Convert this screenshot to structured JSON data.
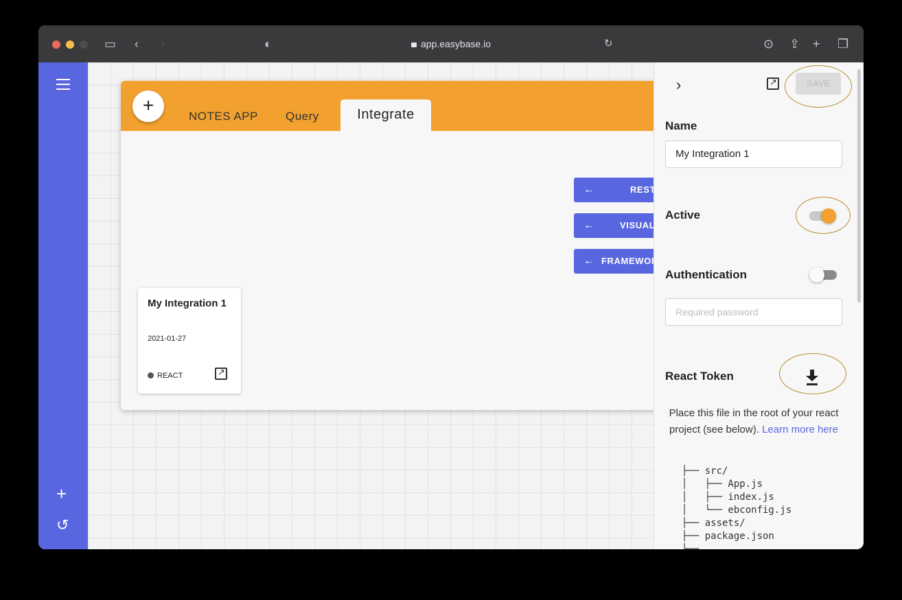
{
  "browser": {
    "url": "app.easybase.io"
  },
  "sidebar": {
    "menu_icon": "hamburger-icon",
    "add_icon": "plus-icon",
    "history_icon": "undo-icon"
  },
  "main": {
    "add_button": "+",
    "tabs": [
      {
        "label": "NOTES APP"
      },
      {
        "label": "Query"
      },
      {
        "label": "Integrate"
      }
    ],
    "actions": [
      {
        "label": "REST"
      },
      {
        "label": "VISUAL"
      },
      {
        "label": "FRAMEWORK"
      }
    ],
    "integration": {
      "title": "My Integration 1",
      "date": "2021-01-27",
      "framework": "REACT"
    }
  },
  "panel": {
    "save_label": "SAVE",
    "name_label": "Name",
    "name_value": "My Integration 1",
    "active_label": "Active",
    "active_on": true,
    "auth_label": "Authentication",
    "auth_on": false,
    "password_placeholder": "Required password",
    "token_label": "React Token",
    "desc_text": "Place this file in the root of your react project (see below).",
    "desc_link": "Learn more here",
    "tree_lines": [
      "├── src/",
      "│   ├── App.js",
      "│   ├── index.js",
      "│   └── ebconfig.js",
      "├── assets/",
      "├── package.json",
      "└──"
    ]
  },
  "colors": {
    "accent": "#5866e0",
    "header": "#f2a12e",
    "highlight": "#b88a2a"
  }
}
